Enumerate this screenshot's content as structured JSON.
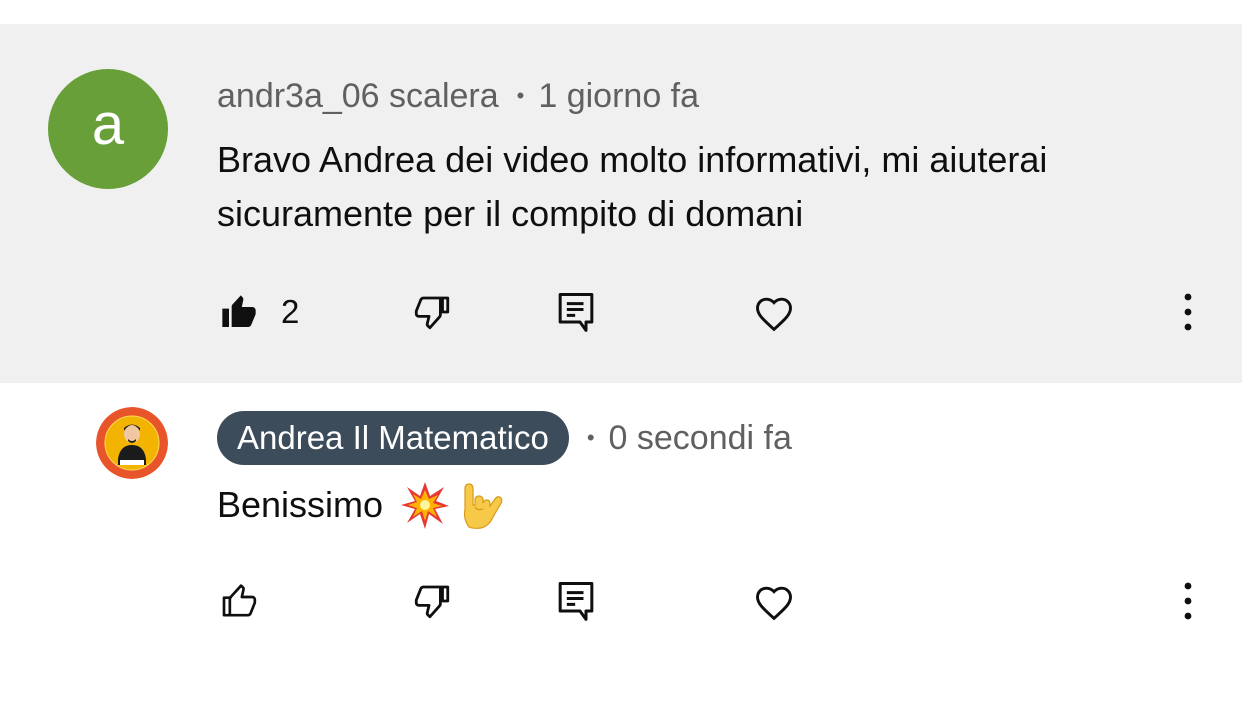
{
  "comments": [
    {
      "avatar_letter": "a",
      "avatar_color": "#689f38",
      "author": "andr3a_06 scalera",
      "time": "1 giorno fa",
      "text": "Bravo Andrea dei video molto informativi, mi aiuterai sicuramente per il compito di domani",
      "likes": "2",
      "liked": true
    },
    {
      "author": "Andrea Il Matematico",
      "author_chip_color": "#3d4c5a",
      "time": "0 secondi fa",
      "text": "Benissimo",
      "emojis": [
        "collision-emoji",
        "sign-of-the-horns-emoji"
      ],
      "liked": false
    }
  ],
  "separator": "•",
  "icons": [
    "thumbs-up-icon",
    "thumbs-down-icon",
    "reply-icon",
    "heart-icon",
    "more-vert-icon"
  ],
  "colors": {
    "highlight_bg": "#f0f0f0",
    "secondary_text": "#606060"
  }
}
